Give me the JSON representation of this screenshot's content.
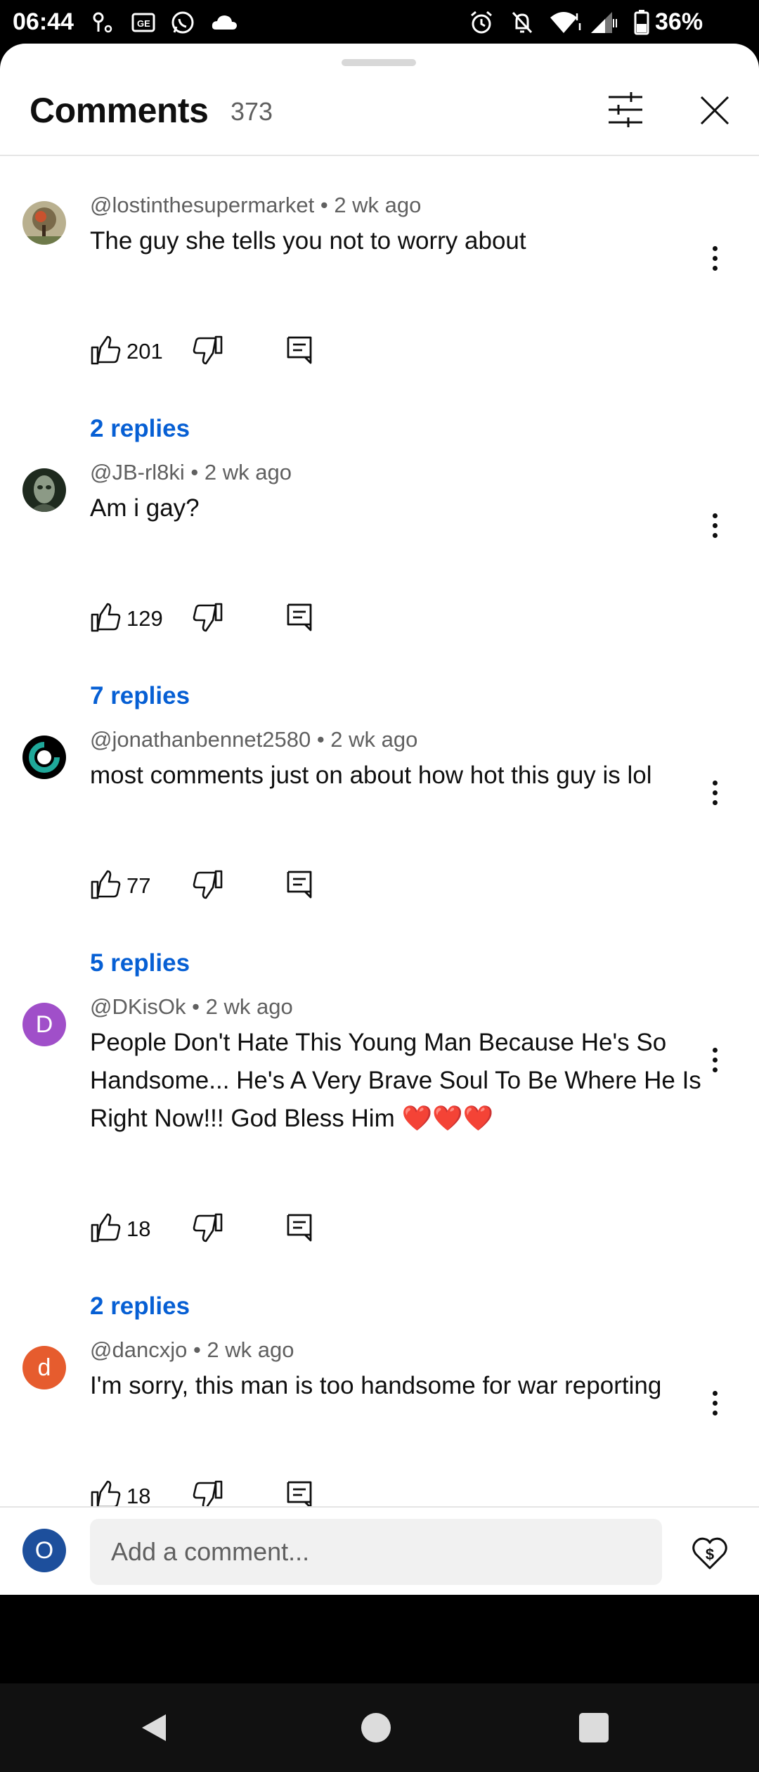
{
  "status_bar": {
    "time": "06:44",
    "battery": "36%",
    "left_icons": [
      "location-icon",
      "news-icon",
      "whatsapp-icon",
      "cloud-icon"
    ],
    "right_icons": [
      "alarm-icon",
      "bell-off-icon",
      "wifi-icon",
      "signal-icon",
      "battery-icon"
    ]
  },
  "header": {
    "title": "Comments",
    "count": "373"
  },
  "comments": [
    {
      "author": "@lostinthesupermarket",
      "age": "2 wk ago",
      "text": "The guy she tells you not to worry about",
      "likes": "201",
      "replies": "2 replies",
      "avatar": "photo"
    },
    {
      "author": "@JB-rl8ki",
      "age": "2 wk ago",
      "text": "Am i gay?",
      "likes": "129",
      "replies": "7 replies",
      "avatar": "photo"
    },
    {
      "author": "@jonathanbennet2580",
      "age": "2 wk ago",
      "text": "most comments just on about how hot this guy is lol",
      "likes": "77",
      "replies": "5 replies",
      "avatar": "photo"
    },
    {
      "author": "@DKisOk",
      "age": "2 wk ago",
      "text": "People Don't Hate This Young Man Because He's So Handsome... He's A Very Brave Soul To Be Where He Is Right Now!!! God Bless Him ❤️❤️❤️",
      "likes": "18",
      "replies": "2 replies",
      "avatar_letter": "D",
      "avatar_color": "#a04fc9"
    },
    {
      "author": "@dancxjo",
      "age": "2 wk ago",
      "text": "I'm sorry, this man is too handsome for war reporting",
      "likes": "18",
      "avatar_letter": "d",
      "avatar_color": "#e65c2e"
    }
  ],
  "composer": {
    "avatar_letter": "O",
    "avatar_color": "#1d4f9c",
    "placeholder": "Add a comment..."
  },
  "colors": {
    "link": "#065fd4",
    "text": "#0f0f0f",
    "secondary": "#606060"
  }
}
